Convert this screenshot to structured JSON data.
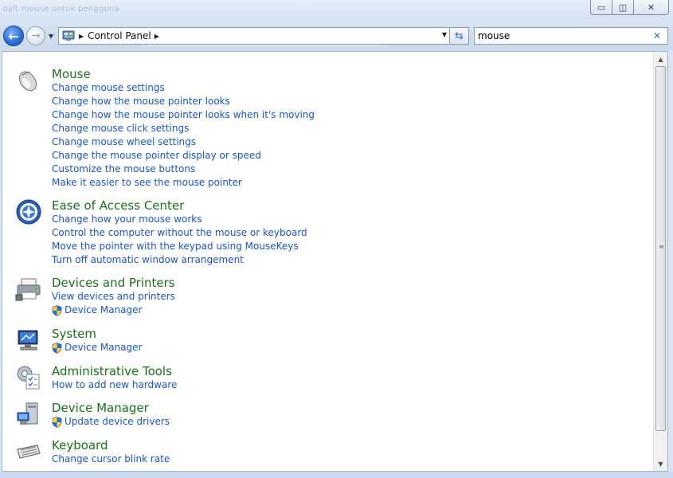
{
  "window": {
    "ghost_caption": "daft mouse untuk pengguna",
    "minimize_glyph": "▭",
    "maximize_glyph": "◫",
    "close_glyph": "✕"
  },
  "nav": {
    "back_icon": "back-arrow-icon",
    "forward_icon": "forward-arrow-icon",
    "back_glyph": "←",
    "forward_glyph": "→",
    "recent_glyph": "▼"
  },
  "address": {
    "crumb": "Control Panel",
    "arrow_glyph": "▶",
    "dropdown_glyph": "▼",
    "refresh_glyph": "⇆"
  },
  "search": {
    "value": "mouse",
    "clear_glyph": "✕"
  },
  "colors": {
    "heading": "#1e6d1e",
    "link": "#1d55b8"
  },
  "groups": [
    {
      "title": "Mouse",
      "icon": "mouse-icon",
      "tasks": [
        {
          "label": "Change mouse settings",
          "shield": false
        },
        {
          "label": "Change how the mouse pointer looks",
          "shield": false
        },
        {
          "label": "Change how the mouse pointer looks when it's moving",
          "shield": false
        },
        {
          "label": "Change mouse click settings",
          "shield": false
        },
        {
          "label": "Change mouse wheel settings",
          "shield": false
        },
        {
          "label": "Change the mouse pointer display or speed",
          "shield": false
        },
        {
          "label": "Customize the mouse buttons",
          "shield": false
        },
        {
          "label": "Make it easier to see the mouse pointer",
          "shield": false
        }
      ]
    },
    {
      "title": "Ease of Access Center",
      "icon": "ease-of-access-icon",
      "tasks": [
        {
          "label": "Change how your mouse works",
          "shield": false
        },
        {
          "label": "Control the computer without the mouse or keyboard",
          "shield": false
        },
        {
          "label": "Move the pointer with the keypad using MouseKeys",
          "shield": false
        },
        {
          "label": "Turn off automatic window arrangement",
          "shield": false
        }
      ]
    },
    {
      "title": "Devices and Printers",
      "icon": "devices-printers-icon",
      "tasks": [
        {
          "label": "View devices and printers",
          "shield": false
        },
        {
          "label": "Device Manager",
          "shield": true
        }
      ]
    },
    {
      "title": "System",
      "icon": "system-icon",
      "tasks": [
        {
          "label": "Device Manager",
          "shield": true
        }
      ]
    },
    {
      "title": "Administrative Tools",
      "icon": "administrative-tools-icon",
      "tasks": [
        {
          "label": "How to add new hardware",
          "shield": false
        }
      ]
    },
    {
      "title": "Device Manager",
      "icon": "device-manager-icon",
      "tasks": [
        {
          "label": "Update device drivers",
          "shield": true
        }
      ]
    },
    {
      "title": "Keyboard",
      "icon": "keyboard-icon",
      "tasks": [
        {
          "label": "Change cursor blink rate",
          "shield": false
        }
      ]
    }
  ],
  "scrollbar": {
    "up_glyph": "▲",
    "down_glyph": "▼",
    "grip_glyph": "≡"
  }
}
